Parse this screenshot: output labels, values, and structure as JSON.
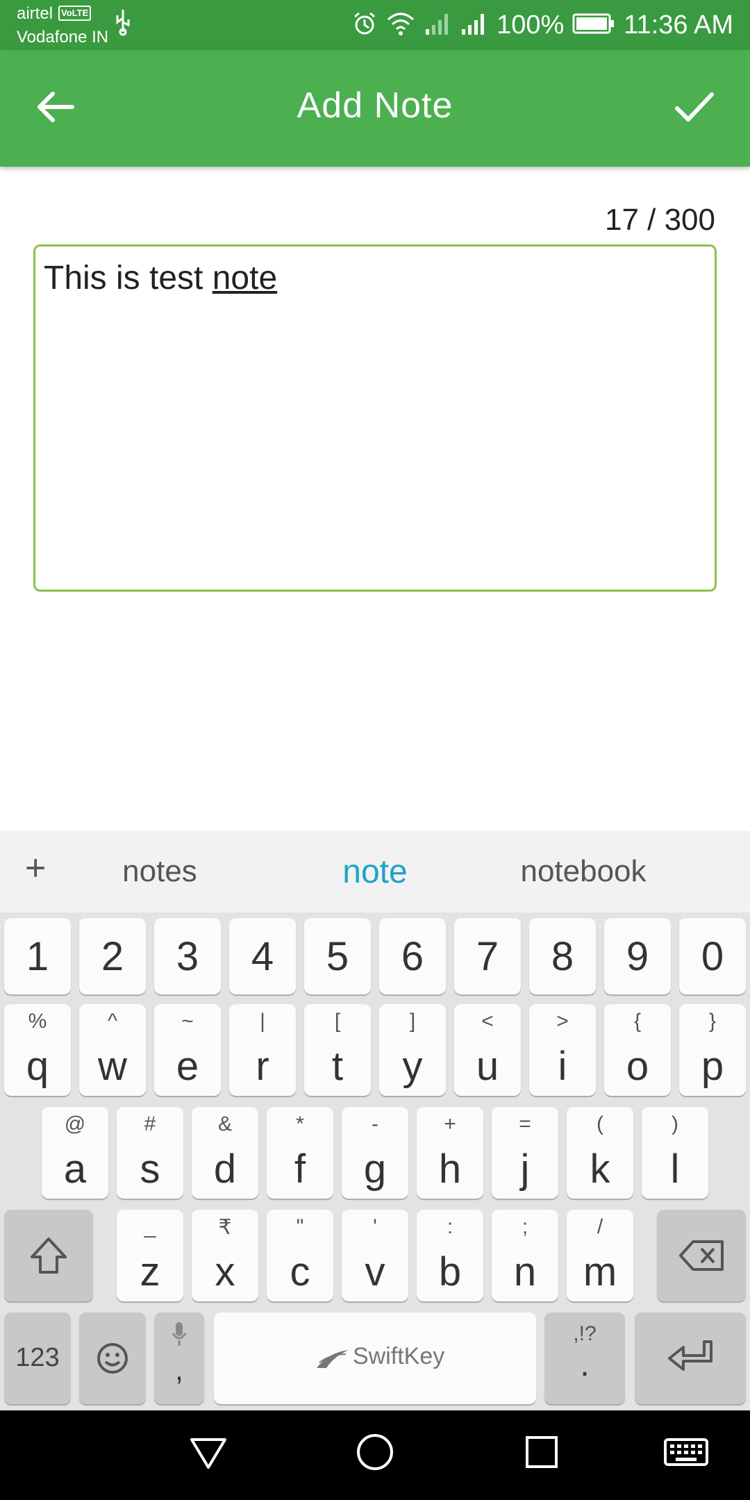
{
  "status_bar": {
    "carrier_primary": "airtel",
    "volte_badge": "VoLTE",
    "carrier_secondary": "Vodafone IN",
    "battery": "100%",
    "time": "11:36 AM"
  },
  "app_bar": {
    "title": "Add Note",
    "back_icon": "arrow-left-icon",
    "confirm_icon": "check-icon",
    "color": "#4caf50"
  },
  "note": {
    "counter": "17 / 300",
    "text_plain": "This is test ",
    "text_underlined": "note",
    "border_color": "#8bc34a"
  },
  "keyboard": {
    "suggestions": [
      "notes",
      "note",
      "notebook"
    ],
    "plus_label": "+",
    "number_row": [
      "1",
      "2",
      "3",
      "4",
      "5",
      "6",
      "7",
      "8",
      "9",
      "0"
    ],
    "row1": [
      {
        "main": "q",
        "sub": "%"
      },
      {
        "main": "w",
        "sub": "^"
      },
      {
        "main": "e",
        "sub": "~"
      },
      {
        "main": "r",
        "sub": "|"
      },
      {
        "main": "t",
        "sub": "["
      },
      {
        "main": "y",
        "sub": "]"
      },
      {
        "main": "u",
        "sub": "<"
      },
      {
        "main": "i",
        "sub": ">"
      },
      {
        "main": "o",
        "sub": "{"
      },
      {
        "main": "p",
        "sub": "}"
      }
    ],
    "row2": [
      {
        "main": "a",
        "sub": "@"
      },
      {
        "main": "s",
        "sub": "#"
      },
      {
        "main": "d",
        "sub": "&"
      },
      {
        "main": "f",
        "sub": "*"
      },
      {
        "main": "g",
        "sub": "-"
      },
      {
        "main": "h",
        "sub": "+"
      },
      {
        "main": "j",
        "sub": "="
      },
      {
        "main": "k",
        "sub": "("
      },
      {
        "main": "l",
        "sub": ")"
      }
    ],
    "row3": [
      {
        "main": "z",
        "sub": "_"
      },
      {
        "main": "x",
        "sub": "₹"
      },
      {
        "main": "c",
        "sub": "\""
      },
      {
        "main": "v",
        "sub": "'"
      },
      {
        "main": "b",
        "sub": ":"
      },
      {
        "main": "n",
        "sub": ";"
      },
      {
        "main": "m",
        "sub": "/"
      }
    ],
    "symbols_label": "123",
    "comma_label": ",",
    "space_label": "SwiftKey",
    "period_sub": ",!?",
    "period_label": "."
  }
}
